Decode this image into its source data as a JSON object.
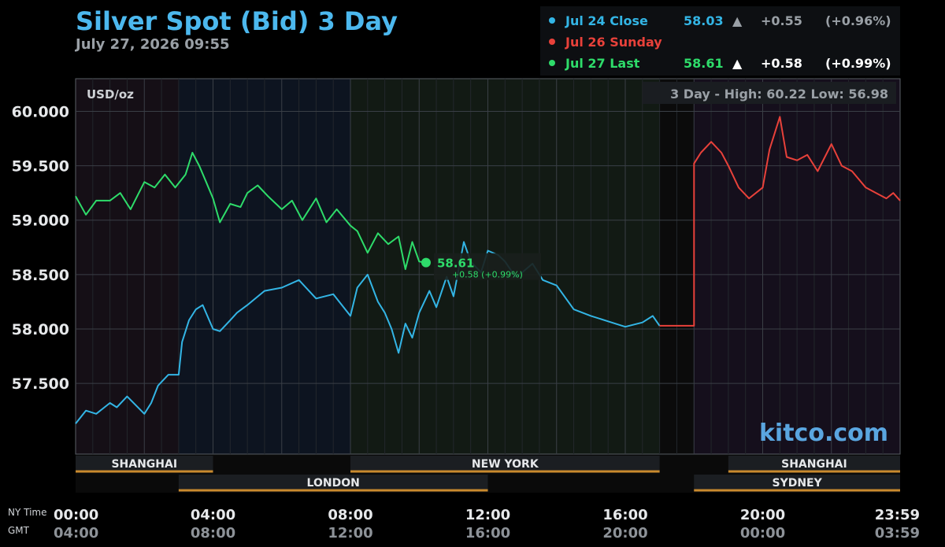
{
  "title": "Silver Spot (Bid) 3 Day",
  "subtitle": "July 27, 2026 09:55",
  "legend": [
    {
      "label": "Jul 24 Close",
      "value": "58.03",
      "arrow": "▲",
      "change": "+0.55",
      "pct": "(+0.96%)",
      "color": "#33b5e5",
      "value_color": "#33b5e5",
      "detail_color": "#9aa0a6"
    },
    {
      "label": "Jul 26 Sunday",
      "value": "",
      "arrow": "",
      "change": "",
      "pct": "",
      "color": "#e8413a",
      "value_color": "#e8413a",
      "detail_color": "#9aa0a6"
    },
    {
      "label": "Jul 27 Last",
      "value": "58.61",
      "arrow": "▲",
      "change": "+0.58",
      "pct": "(+0.99%)",
      "color": "#2edc6a",
      "value_color": "#2edc6a",
      "detail_color": "#ffffff"
    }
  ],
  "chart": {
    "unit": "USD/oz",
    "range_text": "3 Day - High: 60.22  Low: 56.98",
    "watermark": "kitco.com",
    "current_value": "58.61",
    "current_change": "+0.58 (+0.99%)",
    "ny_time_label": "NY Time",
    "gmt_label": "GMT",
    "ny_ticks": [
      "00:00",
      "04:00",
      "08:00",
      "12:00",
      "16:00",
      "20:00",
      "23:59"
    ],
    "gmt_ticks": [
      "04:00",
      "08:00",
      "12:00",
      "16:00",
      "20:00",
      "00:00",
      "03:59"
    ],
    "y_ticks": [
      "60.000",
      "59.500",
      "59.000",
      "58.500",
      "58.000",
      "57.500"
    ],
    "sessions_top": [
      {
        "name": "SHANGHAI",
        "start": 0,
        "end": 4
      },
      {
        "name": "NEW YORK",
        "start": 8,
        "end": 17
      },
      {
        "name": "SHANGHAI",
        "start": 19,
        "end": 24
      }
    ],
    "sessions_bottom": [
      {
        "name": "LONDON",
        "start": 3,
        "end": 12
      },
      {
        "name": "SYDNEY",
        "start": 18,
        "end": 24
      }
    ],
    "colors": {
      "jul24": "#33b5e5",
      "jul26": "#e8413a",
      "jul27": "#2edc6a",
      "session_bar": "#c98a2e"
    }
  },
  "chart_data": {
    "type": "line",
    "title": "Silver Spot (Bid) 3 Day",
    "ylabel": "USD/oz",
    "xlabel": "",
    "ylim": [
      56.85,
      60.3
    ],
    "xlim_hours": [
      0,
      24
    ],
    "series": [
      {
        "name": "Jul 24 Close",
        "color": "#33b5e5",
        "x": [
          0,
          0.3,
          0.6,
          1.0,
          1.2,
          1.5,
          2.0,
          2.2,
          2.4,
          2.7,
          3.0,
          3.1,
          3.3,
          3.5,
          3.7,
          4.0,
          4.2,
          4.5,
          4.7,
          5.0,
          5.5,
          6.0,
          6.5,
          7.0,
          7.5,
          8.0,
          8.2,
          8.5,
          8.8,
          9.0,
          9.2,
          9.4,
          9.6,
          9.8,
          10.0,
          10.3,
          10.5,
          10.8,
          11.0,
          11.3,
          11.5,
          11.8,
          12.0,
          12.3,
          12.5,
          12.8,
          13.0,
          13.3,
          13.6,
          14.0,
          14.5,
          15.0,
          15.5,
          16.0,
          16.5,
          16.8,
          17.0
        ],
        "y": [
          57.13,
          57.25,
          57.22,
          57.32,
          57.28,
          57.38,
          57.22,
          57.32,
          57.48,
          57.58,
          57.58,
          57.88,
          58.08,
          58.18,
          58.22,
          58.0,
          57.98,
          58.08,
          58.15,
          58.22,
          58.35,
          58.38,
          58.45,
          58.28,
          58.32,
          58.12,
          58.38,
          58.5,
          58.25,
          58.15,
          58.0,
          57.78,
          58.05,
          57.92,
          58.15,
          58.35,
          58.2,
          58.48,
          58.3,
          58.8,
          58.62,
          58.52,
          58.72,
          58.68,
          58.62,
          58.48,
          58.52,
          58.6,
          58.45,
          58.4,
          58.18,
          58.12,
          58.07,
          58.02,
          58.06,
          58.12,
          58.03
        ]
      },
      {
        "name": "Jul 26 Sunday",
        "color": "#e8413a",
        "x": [
          17.0,
          18.0,
          18.0,
          18.2,
          18.5,
          18.8,
          19.0,
          19.3,
          19.6,
          20.0,
          20.2,
          20.5,
          20.7,
          21.0,
          21.3,
          21.6,
          22.0,
          22.3,
          22.6,
          23.0,
          23.3,
          23.6,
          23.8,
          24.0
        ],
        "y": [
          58.03,
          58.03,
          59.52,
          59.62,
          59.72,
          59.62,
          59.5,
          59.3,
          59.2,
          59.3,
          59.65,
          59.95,
          59.58,
          59.55,
          59.6,
          59.45,
          59.7,
          59.5,
          59.45,
          59.3,
          59.25,
          59.2,
          59.25,
          59.18
        ]
      },
      {
        "name": "Jul 27 Last",
        "color": "#2edc6a",
        "x": [
          0,
          0.3,
          0.6,
          1.0,
          1.3,
          1.6,
          2.0,
          2.3,
          2.6,
          2.9,
          3.2,
          3.4,
          3.6,
          3.8,
          4.0,
          4.2,
          4.5,
          4.8,
          5.0,
          5.3,
          5.6,
          6.0,
          6.3,
          6.6,
          7.0,
          7.3,
          7.6,
          8.0,
          8.2,
          8.5,
          8.8,
          9.1,
          9.4,
          9.6,
          9.8,
          10.0,
          10.2
        ],
        "y": [
          59.22,
          59.05,
          59.18,
          59.18,
          59.25,
          59.1,
          59.35,
          59.3,
          59.42,
          59.3,
          59.42,
          59.62,
          59.5,
          59.35,
          59.2,
          58.98,
          59.15,
          59.12,
          59.25,
          59.32,
          59.22,
          59.1,
          59.18,
          59.0,
          59.2,
          58.98,
          59.1,
          58.95,
          58.9,
          58.7,
          58.88,
          58.78,
          58.85,
          58.55,
          58.8,
          58.62,
          58.61
        ]
      }
    ],
    "annotations": [
      {
        "x": 10.2,
        "y": 58.61,
        "text": "58.61"
      }
    ]
  }
}
